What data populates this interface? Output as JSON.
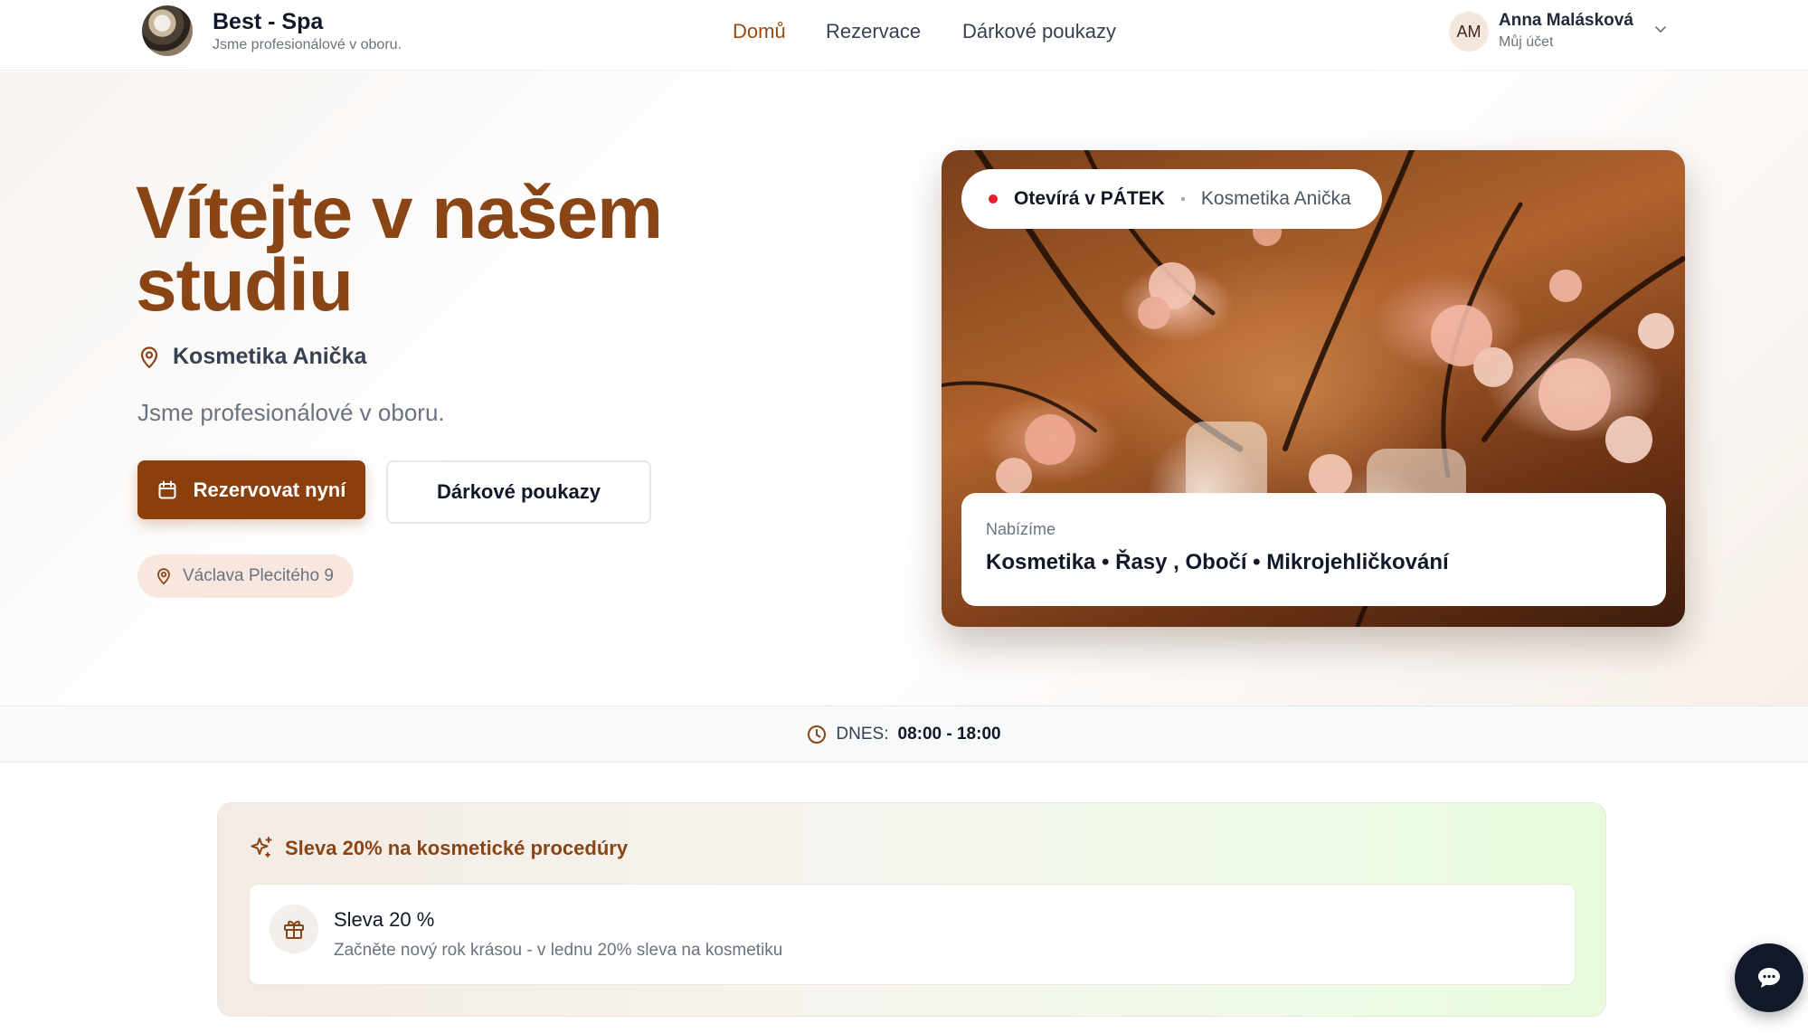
{
  "header": {
    "brand_title": "Best - Spa",
    "brand_subtitle": "Jsme profesionálové v oboru.",
    "nav": [
      {
        "label": "Domů",
        "active": true
      },
      {
        "label": "Rezervace",
        "active": false
      },
      {
        "label": "Dárkové poukazy",
        "active": false
      }
    ],
    "user": {
      "initials": "AM",
      "name": "Anna Malásková",
      "account_label": "Můj účet"
    }
  },
  "hero": {
    "title": "Vítejte v našem studiu",
    "location_name": "Kosmetika Anička",
    "tagline": "Jsme profesionálové v oboru.",
    "primary_button": "Rezervovat nyní",
    "secondary_button": "Dárkové poukazy",
    "address": "Václava Plecitého 9"
  },
  "photo_card": {
    "status": "Otevírá v PÁTEK",
    "place": "Kosmetika Anička",
    "offer_label": "Nabízíme",
    "offer_text": "Kosmetika • Řasy , Obočí • Mikrojehličkování"
  },
  "hours": {
    "label": "DNES:",
    "time": "08:00 - 18:00"
  },
  "promo": {
    "title": "Sleva 20% na kosmetické procedúry",
    "item_title": "Sleva 20 %",
    "item_desc": "Začněte nový rok krásou - v lednu 20% sleva na kosmetiku"
  },
  "colors": {
    "accent": "#8a3f0d",
    "title_brown": "#8a4516",
    "status_dot": "#e11d2e"
  },
  "icons": [
    "map-pin-icon",
    "calendar-icon",
    "clock-icon",
    "sparkles-icon",
    "gift-icon",
    "chat-icon",
    "chevron-down-icon"
  ]
}
